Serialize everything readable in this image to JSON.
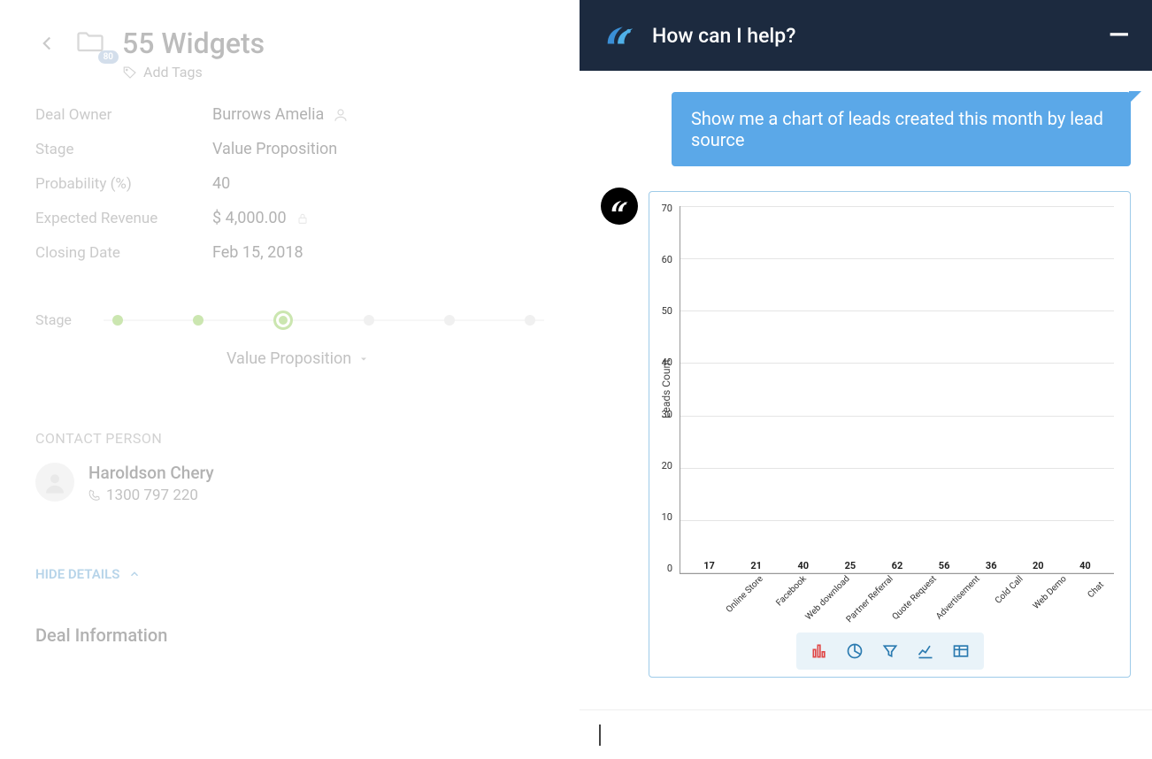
{
  "deal": {
    "title": "55 Widgets",
    "badge": "80",
    "add_tags_label": "Add Tags",
    "fields": {
      "owner_label": "Deal Owner",
      "owner_value": "Burrows Amelia",
      "stage_label": "Stage",
      "stage_value": "Value Proposition",
      "probability_label": "Probability (%)",
      "probability_value": "40",
      "revenue_label": "Expected Revenue",
      "revenue_value": "$ 4,000.00",
      "closing_label": "Closing Date",
      "closing_value": "Feb 15, 2018"
    },
    "stepper_label": "Stage",
    "stepper_stage": "Value Proposition",
    "contact_heading": "CONTACT PERSON",
    "contact_name": "Haroldson Chery",
    "contact_phone": "1300 797 220",
    "hide_details_label": "HIDE DETAILS",
    "deal_info_heading": "Deal Information"
  },
  "assistant": {
    "header_title": "How can I help?",
    "user_message": "Show me a chart of leads created this month by lead source",
    "input_placeholder": ""
  },
  "chart_data": {
    "type": "bar",
    "ylabel": "Leads Count",
    "ylim": [
      0,
      70
    ],
    "y_ticks": [
      70,
      60,
      50,
      40,
      30,
      20,
      10,
      0
    ],
    "categories": [
      "Online Store",
      "Facebook",
      "Web download",
      "Partner Referral",
      "Quote Request",
      "Advertisement",
      "Cold Call",
      "Web Demo",
      "Chat"
    ],
    "values": [
      17,
      21,
      40,
      25,
      62,
      56,
      36,
      20,
      40
    ],
    "colors": [
      "#ef4e4e",
      "#f76fa8",
      "#8a56d6",
      "#2e7fd1",
      "#26bdef",
      "#1fd1b0",
      "#6ebd45",
      "#b7d53c",
      "#f08a3c"
    ]
  },
  "chart_toolbar": {
    "bar": "bar-chart",
    "pie": "pie-chart",
    "filter": "filter",
    "line": "line-chart",
    "table": "table"
  }
}
